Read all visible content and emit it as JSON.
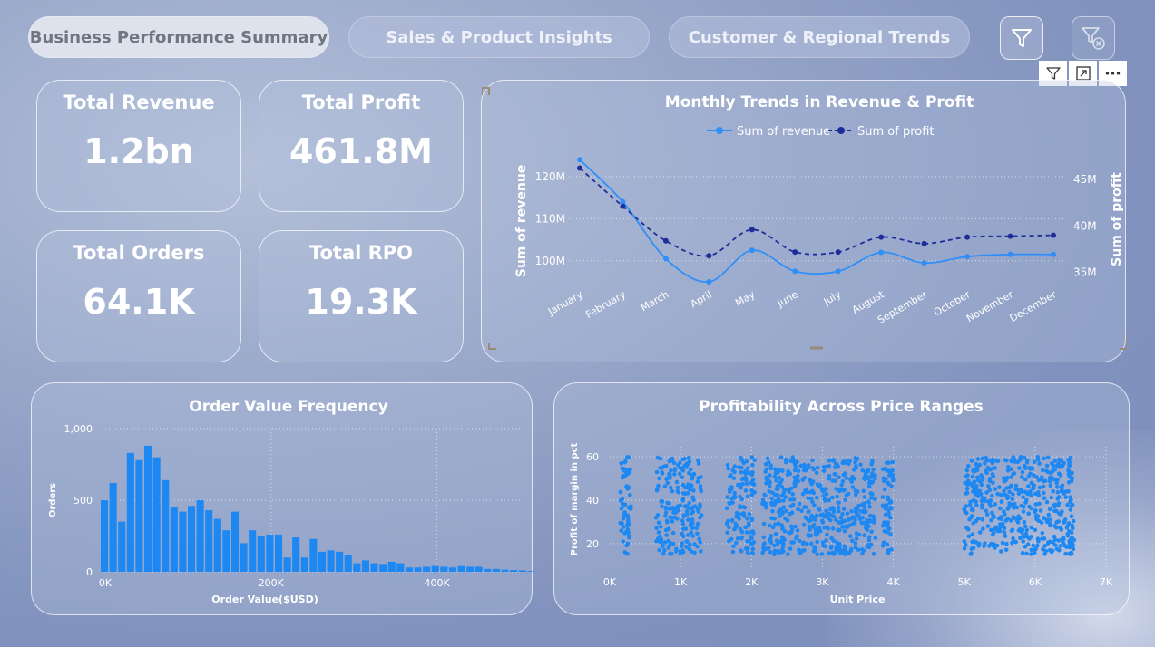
{
  "tabs": [
    {
      "label": "Business Performance Summary",
      "active": true
    },
    {
      "label": "Sales & Product Insights",
      "active": false
    },
    {
      "label": "Customer & Regional Trends",
      "active": false
    }
  ],
  "toolbar": {
    "filter_icon": "filter-icon",
    "clear_filter_icon": "clear-filter-icon",
    "visual_filter_icon": "filter-icon",
    "focus_mode_icon": "focus-mode-icon",
    "more_options_label": "⋯"
  },
  "kpis": {
    "revenue": {
      "label": "Total Revenue",
      "value": "1.2bn"
    },
    "profit": {
      "label": "Total Profit",
      "value": "461.8M"
    },
    "orders": {
      "label": "Total Orders",
      "value": "64.1K"
    },
    "rpo": {
      "label": "Total RPO",
      "value": "19.3K"
    }
  },
  "colors": {
    "revenue": "#2f8ff7",
    "profit": "#1e2d9a",
    "bar": "#1e88f2",
    "scatter": "#1e88f2"
  },
  "chart_data": [
    {
      "id": "monthly",
      "type": "line",
      "title": "Monthly Trends in Revenue & Profit",
      "ylabel": "Sum of revenue",
      "y2label": "Sum of profit",
      "x": [
        "January",
        "February",
        "March",
        "April",
        "May",
        "June",
        "July",
        "August",
        "September",
        "October",
        "November",
        "December"
      ],
      "yticks": [
        {
          "v": 100,
          "label": "100M"
        },
        {
          "v": 110,
          "label": "110M"
        },
        {
          "v": 120,
          "label": "120M"
        }
      ],
      "ylim": [
        95,
        126
      ],
      "y2ticks": [
        {
          "v": 35,
          "label": "35M"
        },
        {
          "v": 40,
          "label": "40M"
        },
        {
          "v": 45,
          "label": "45M"
        }
      ],
      "y2lim": [
        34,
        48
      ],
      "series": [
        {
          "name": "Sum of revenue",
          "axis": "left",
          "style": "solid",
          "values": [
            124,
            114,
            100.5,
            95,
            102.5,
            97.5,
            97.5,
            102,
            99.5,
            101,
            101.5,
            101.5
          ]
        },
        {
          "name": "Sum of profit",
          "axis": "right",
          "style": "dashed",
          "values": [
            46.2,
            42.1,
            38.4,
            36.8,
            39.6,
            37.2,
            37.2,
            38.8,
            38.1,
            38.8,
            38.9,
            39.0
          ]
        }
      ],
      "grid": true,
      "legend": "top"
    },
    {
      "id": "histogram",
      "type": "bar",
      "title": "Order Value Frequency",
      "xlabel": "Order Value($USD)",
      "ylabel": "Orders",
      "xticks": [
        {
          "v": 0,
          "label": "0K"
        },
        {
          "v": 200,
          "label": "200K"
        },
        {
          "v": 400,
          "label": "400K"
        }
      ],
      "yticks": [
        {
          "v": 0,
          "label": "0"
        },
        {
          "v": 500,
          "label": "500"
        },
        {
          "v": 1000,
          "label": "1,000"
        }
      ],
      "xlim": [
        0,
        500
      ],
      "ylim": [
        0,
        1000
      ],
      "bin_width": 10.5,
      "values": [
        500,
        620,
        350,
        830,
        780,
        880,
        800,
        640,
        450,
        420,
        460,
        500,
        430,
        370,
        290,
        420,
        200,
        290,
        250,
        260,
        260,
        100,
        240,
        100,
        230,
        140,
        150,
        140,
        120,
        60,
        80,
        60,
        55,
        70,
        60,
        30,
        30,
        35,
        40,
        35,
        30,
        40,
        35,
        35,
        20,
        20,
        15,
        12,
        10,
        5
      ],
      "grid": true
    },
    {
      "id": "scatter",
      "type": "scatter",
      "title": "Profitability Across Price Ranges",
      "xlabel": "Unit Price",
      "ylabel": "Profit of margin in pct",
      "xticks": [
        {
          "v": 0,
          "label": "0K"
        },
        {
          "v": 1000,
          "label": "1K"
        },
        {
          "v": 2000,
          "label": "2K"
        },
        {
          "v": 3000,
          "label": "3K"
        },
        {
          "v": 4000,
          "label": "4K"
        },
        {
          "v": 5000,
          "label": "5K"
        },
        {
          "v": 6000,
          "label": "6K"
        },
        {
          "v": 7000,
          "label": "7K"
        }
      ],
      "yticks": [
        {
          "v": 20,
          "label": "20"
        },
        {
          "v": 40,
          "label": "40"
        },
        {
          "v": 60,
          "label": "60"
        }
      ],
      "xlim": [
        0,
        7000
      ],
      "ylim": [
        12,
        63
      ],
      "price_clusters": [
        [
          150,
          300
        ],
        [
          650,
          1300
        ],
        [
          1650,
          2050
        ],
        [
          2150,
          3750
        ],
        [
          3850,
          4000
        ],
        [
          5000,
          6550
        ]
      ],
      "margin_range": [
        15,
        60
      ],
      "grid": true
    }
  ]
}
